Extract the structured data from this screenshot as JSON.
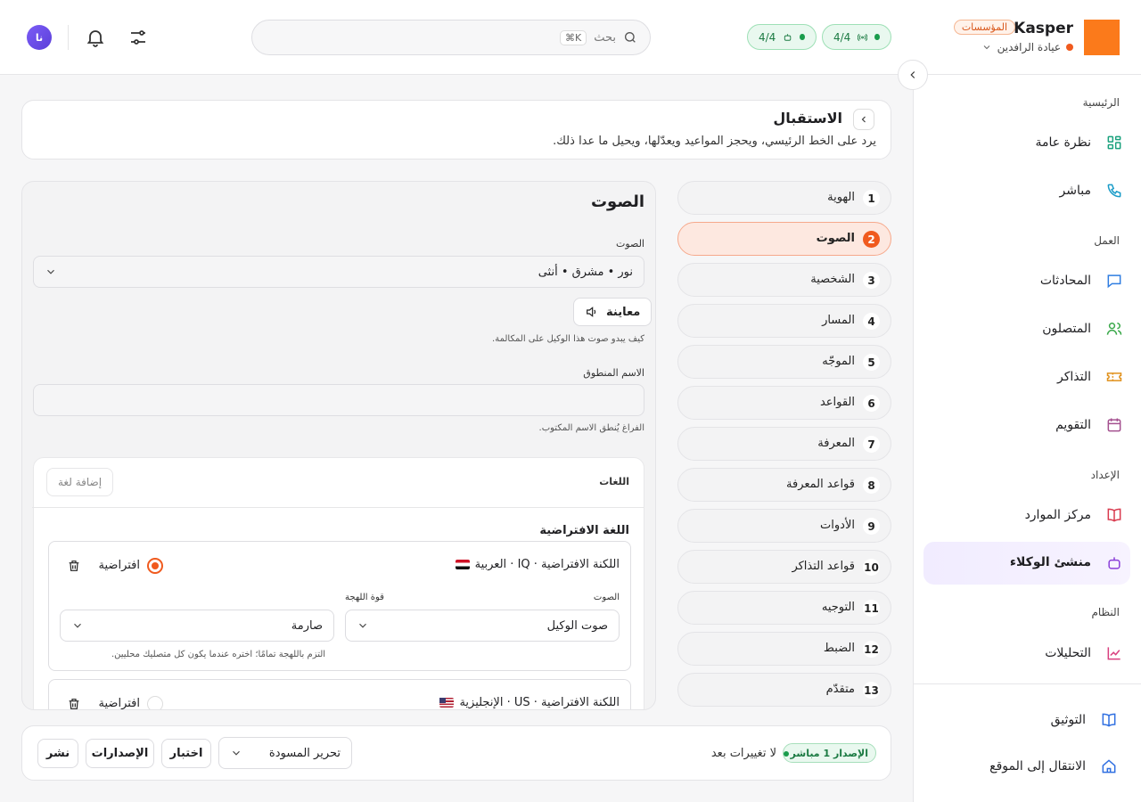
{
  "brand": {
    "name": "Kasper",
    "badge": "المؤسسات",
    "workspace": "عيادة الرافدين",
    "accent": "#fb7a1b"
  },
  "header_stats": [
    {
      "value": "4/4",
      "icon": "antenna-icon"
    },
    {
      "value": "4/4",
      "icon": "bot-icon"
    }
  ],
  "search": {
    "placeholder": "بحث",
    "shortcut": "⌘K"
  },
  "user": {
    "initials": "نا"
  },
  "sidebar": {
    "sections": {
      "main": "الرئيسية",
      "work": "العمل",
      "setup": "الإعداد",
      "system": "النظام"
    },
    "items": [
      {
        "label": "نظرة عامة",
        "icon": "grid-icon"
      },
      {
        "label": "مباشر",
        "icon": "phone-icon"
      },
      {
        "label": "المحادثات",
        "icon": "chat-icon"
      },
      {
        "label": "المتصلون",
        "icon": "users-icon"
      },
      {
        "label": "التذاكر",
        "icon": "ticket-icon"
      },
      {
        "label": "التقويم",
        "icon": "calendar-icon"
      },
      {
        "label": "مركز الموارد",
        "icon": "book-icon"
      },
      {
        "label": "منشئ الوكلاء",
        "icon": "bot-icon"
      },
      {
        "label": "التحليلات",
        "icon": "chart-icon"
      }
    ],
    "bottom": [
      {
        "label": "التوثيق",
        "icon": "docs-icon"
      },
      {
        "label": "الانتقال إلى الموقع",
        "icon": "home-icon"
      }
    ]
  },
  "page": {
    "title": "الاستقبال",
    "description": "يرد على الخط الرئيسي، ويحجز المواعيد ويعدّلها، ويحيل ما عدا ذلك."
  },
  "steps": [
    {
      "num": "1",
      "label": "الهوية"
    },
    {
      "num": "2",
      "label": "الصوت"
    },
    {
      "num": "3",
      "label": "الشخصية"
    },
    {
      "num": "4",
      "label": "المسار"
    },
    {
      "num": "5",
      "label": "الموجّه"
    },
    {
      "num": "6",
      "label": "القواعد"
    },
    {
      "num": "7",
      "label": "المعرفة"
    },
    {
      "num": "8",
      "label": "قواعد المعرفة"
    },
    {
      "num": "9",
      "label": "الأدوات"
    },
    {
      "num": "10",
      "label": "قواعد التذاكر"
    },
    {
      "num": "11",
      "label": "التوجيه"
    },
    {
      "num": "12",
      "label": "الضبط"
    },
    {
      "num": "13",
      "label": "متقدّم"
    }
  ],
  "voice": {
    "title": "الصوت",
    "voice_label": "الصوت",
    "voice_value": "نور • مشرق • أنثى",
    "preview": "معاينة",
    "voice_hint": "كيف يبدو صوت هذا الوكيل على المكالمة.",
    "spoken_label": "الاسم المنطوق",
    "spoken_value": "",
    "spoken_hint": "الفراغ يُنطق الاسم المكتوب.",
    "languages": {
      "title": "اللغات",
      "add": "إضافة لغة",
      "default_heading": "اللغة الافتراضية",
      "rows": [
        {
          "name": "اللكنة الافتراضية · IQ · العربية",
          "flag": "iraq-flag",
          "default_label": "افتراضية",
          "voice_label": "الصوت",
          "voice_value": "صوت الوكيل",
          "strength_label": "قوة اللهجة",
          "strength_value": "صارمة",
          "strength_hint": "التزم باللهجة تمامًا؛ اختره عندما يكون كل متصليك محليين."
        },
        {
          "name": "اللكنة الافتراضية · US · الإنجليزية",
          "flag": "us-flag",
          "default_label": "افتراضية"
        }
      ]
    }
  },
  "footer": {
    "version": "الإصدار 1 مباشر",
    "status": "لا تغييرات بعد",
    "draft": "تحرير المسودة",
    "test": "اختبار",
    "versions": "الإصدارات",
    "publish": "نشر"
  }
}
